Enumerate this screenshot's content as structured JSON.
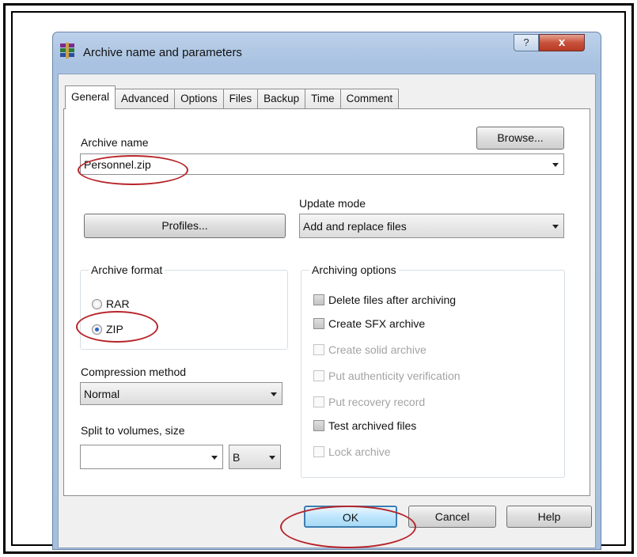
{
  "window": {
    "title": "Archive name and parameters",
    "help_label": "?",
    "close_label": "x"
  },
  "tabs": [
    "General",
    "Advanced",
    "Options",
    "Files",
    "Backup",
    "Time",
    "Comment"
  ],
  "archive_name": {
    "label": "Archive name",
    "value": "Personnel.zip",
    "browse_label": "Browse..."
  },
  "profiles_label": "Profiles...",
  "update_mode": {
    "label": "Update mode",
    "value": "Add and replace files"
  },
  "archive_format": {
    "title": "Archive format",
    "options": [
      "RAR",
      "ZIP"
    ],
    "selected": "ZIP"
  },
  "archiving_options": {
    "title": "Archiving options",
    "items": [
      {
        "label": "Delete files after archiving",
        "enabled": true
      },
      {
        "label": "Create SFX archive",
        "enabled": true
      },
      {
        "label": "Create solid archive",
        "enabled": false
      },
      {
        "label": "Put authenticity verification",
        "enabled": false
      },
      {
        "label": "Put recovery record",
        "enabled": false
      },
      {
        "label": "Test archived files",
        "enabled": true
      },
      {
        "label": "Lock archive",
        "enabled": false
      }
    ]
  },
  "compression_method": {
    "label": "Compression method",
    "value": "Normal"
  },
  "split_volumes": {
    "label": "Split to volumes, size",
    "value": "",
    "unit": "B"
  },
  "buttons": {
    "ok": "OK",
    "cancel": "Cancel",
    "help": "Help"
  },
  "colors": {
    "annotation": "#b7252a",
    "title_bar": "#a9c2e1",
    "close_button": "#c8523c"
  }
}
